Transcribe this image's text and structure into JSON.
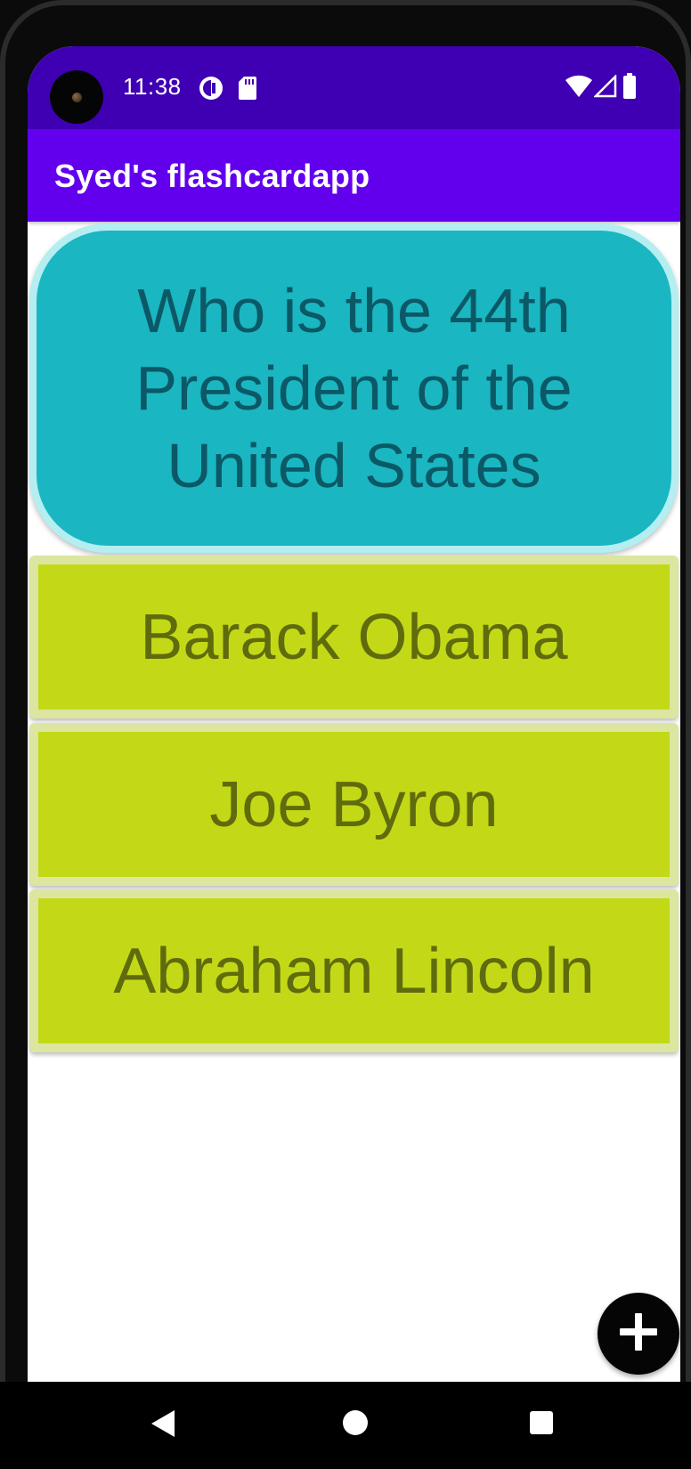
{
  "status_bar": {
    "time": "11:38",
    "icons": [
      "notification-app-icon",
      "sd-card-icon",
      "wifi-icon",
      "cellular-signal-icon",
      "battery-icon"
    ]
  },
  "app_bar": {
    "title": "Syed's flashcardapp"
  },
  "flashcard": {
    "question": "Who is the 44th President of the United States",
    "answers": [
      {
        "label": "Barack Obama"
      },
      {
        "label": "Joe Byron"
      },
      {
        "label": "Abraham Lincoln"
      }
    ]
  },
  "fab": {
    "icon": "plus-icon"
  },
  "navigation_bar": {
    "buttons": [
      "back-icon",
      "home-icon",
      "recents-icon"
    ]
  },
  "colors": {
    "status_bar": "#3f00b4",
    "app_bar": "#6200ee",
    "question_card": "#1ab6c1",
    "question_card_border": "#b4eef1",
    "question_text": "#0b5866",
    "answer_card": "#c3d917",
    "answer_card_border": "#dce6a1",
    "answer_text": "#5f6b0c",
    "fab": "#050505"
  }
}
